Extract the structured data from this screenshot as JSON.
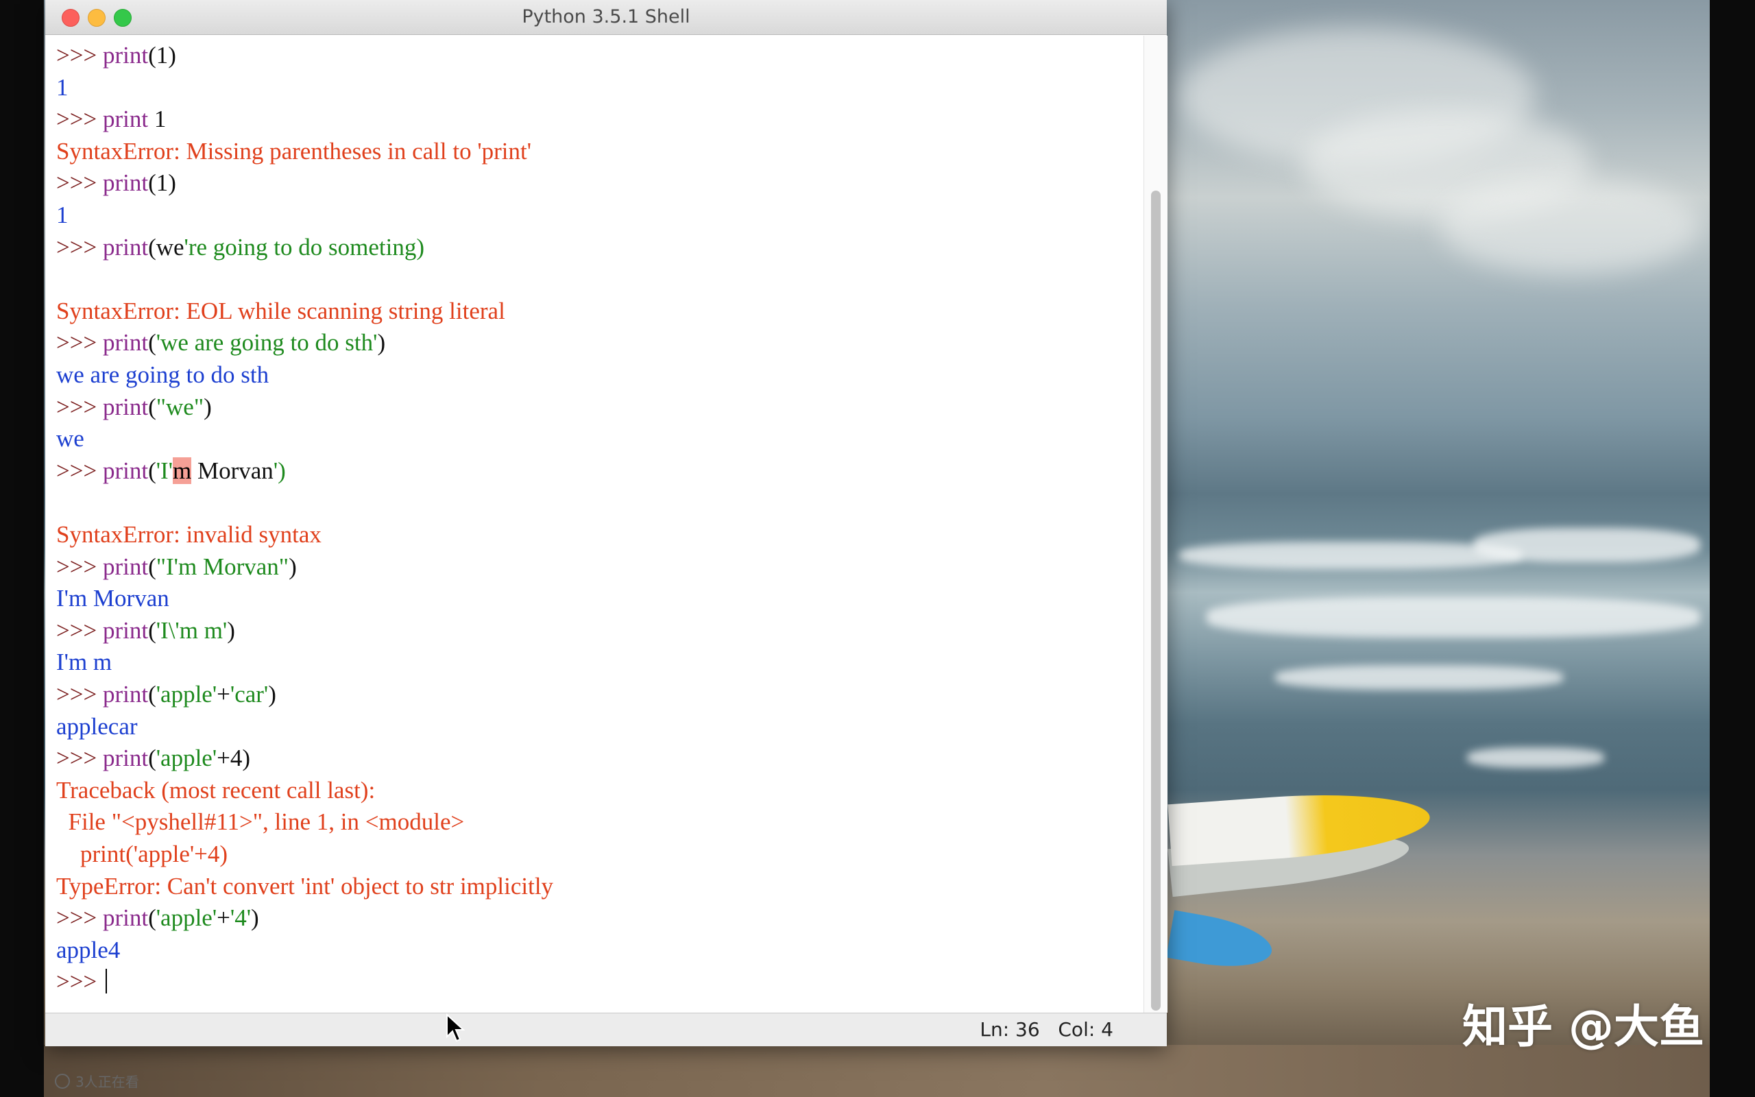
{
  "window": {
    "title": "Python 3.5.1 Shell",
    "status": "Ln: 36   Col: 4"
  },
  "colors": {
    "prompt": "#7a1c1c",
    "builtin": "#8a2a8c",
    "string": "#1e8a1e",
    "stdout": "#1c3fd0",
    "error": "#e0401c",
    "highlight": "#f5a096"
  },
  "shell": {
    "prompt": ">>>",
    "lines": [
      {
        "kind": "input",
        "parts": [
          {
            "t": "print",
            "c": "kw"
          },
          {
            "t": "(1)",
            "c": "plain"
          }
        ]
      },
      {
        "kind": "output",
        "text": "1"
      },
      {
        "kind": "input",
        "parts": [
          {
            "t": "print",
            "c": "kw"
          },
          {
            "t": " 1",
            "c": "plain"
          }
        ]
      },
      {
        "kind": "error",
        "text": "SyntaxError: Missing parentheses in call to 'print'"
      },
      {
        "kind": "input",
        "parts": [
          {
            "t": "print",
            "c": "kw"
          },
          {
            "t": "(1)",
            "c": "plain"
          }
        ]
      },
      {
        "kind": "output",
        "text": "1"
      },
      {
        "kind": "input",
        "parts": [
          {
            "t": "print",
            "c": "kw"
          },
          {
            "t": "(we",
            "c": "plain"
          },
          {
            "t": "'re going to do someting)",
            "c": "str"
          }
        ]
      },
      {
        "kind": "blank"
      },
      {
        "kind": "error",
        "text": "SyntaxError: EOL while scanning string literal"
      },
      {
        "kind": "input",
        "parts": [
          {
            "t": "print",
            "c": "kw"
          },
          {
            "t": "(",
            "c": "plain"
          },
          {
            "t": "'we are going to do sth'",
            "c": "str"
          },
          {
            "t": ")",
            "c": "plain"
          }
        ]
      },
      {
        "kind": "output",
        "text": "we are going to do sth"
      },
      {
        "kind": "input",
        "parts": [
          {
            "t": "print",
            "c": "kw"
          },
          {
            "t": "(",
            "c": "plain"
          },
          {
            "t": "\"we\"",
            "c": "str"
          },
          {
            "t": ")",
            "c": "plain"
          }
        ]
      },
      {
        "kind": "output",
        "text": "we"
      },
      {
        "kind": "input",
        "parts": [
          {
            "t": "print",
            "c": "kw"
          },
          {
            "t": "(",
            "c": "plain"
          },
          {
            "t": "'I'",
            "c": "str"
          },
          {
            "t": "m",
            "c": "hl"
          },
          {
            "t": " Morvan",
            "c": "plain"
          },
          {
            "t": "')",
            "c": "str"
          }
        ]
      },
      {
        "kind": "blank"
      },
      {
        "kind": "error",
        "text": "SyntaxError: invalid syntax"
      },
      {
        "kind": "input",
        "parts": [
          {
            "t": "print",
            "c": "kw"
          },
          {
            "t": "(",
            "c": "plain"
          },
          {
            "t": "\"I'm Morvan\"",
            "c": "str"
          },
          {
            "t": ")",
            "c": "plain"
          }
        ]
      },
      {
        "kind": "output",
        "text": "I'm Morvan"
      },
      {
        "kind": "input",
        "parts": [
          {
            "t": "print",
            "c": "kw"
          },
          {
            "t": "(",
            "c": "plain"
          },
          {
            "t": "'I\\'m m'",
            "c": "str"
          },
          {
            "t": ")",
            "c": "plain"
          }
        ]
      },
      {
        "kind": "output",
        "text": "I'm m"
      },
      {
        "kind": "input",
        "parts": [
          {
            "t": "print",
            "c": "kw"
          },
          {
            "t": "(",
            "c": "plain"
          },
          {
            "t": "'apple'",
            "c": "str"
          },
          {
            "t": "+",
            "c": "plain"
          },
          {
            "t": "'car'",
            "c": "str"
          },
          {
            "t": ")",
            "c": "plain"
          }
        ]
      },
      {
        "kind": "output",
        "text": "applecar"
      },
      {
        "kind": "input",
        "parts": [
          {
            "t": "print",
            "c": "kw"
          },
          {
            "t": "(",
            "c": "plain"
          },
          {
            "t": "'apple'",
            "c": "str"
          },
          {
            "t": "+4)",
            "c": "plain"
          }
        ]
      },
      {
        "kind": "error",
        "text": "Traceback (most recent call last):"
      },
      {
        "kind": "error",
        "text": "  File \"<pyshell#11>\", line 1, in <module>"
      },
      {
        "kind": "error",
        "text": "    print('apple'+4)"
      },
      {
        "kind": "error",
        "text": "TypeError: Can't convert 'int' object to str implicitly"
      },
      {
        "kind": "input",
        "parts": [
          {
            "t": "print",
            "c": "kw"
          },
          {
            "t": "(",
            "c": "plain"
          },
          {
            "t": "'apple'",
            "c": "str"
          },
          {
            "t": "+",
            "c": "plain"
          },
          {
            "t": "'4'",
            "c": "str"
          },
          {
            "t": ")",
            "c": "plain"
          }
        ]
      },
      {
        "kind": "output",
        "text": "apple4"
      },
      {
        "kind": "input",
        "parts": [],
        "active": true
      }
    ]
  },
  "overlay": {
    "watermark": "知乎 @大鱼",
    "viewers": "3人正在看"
  }
}
